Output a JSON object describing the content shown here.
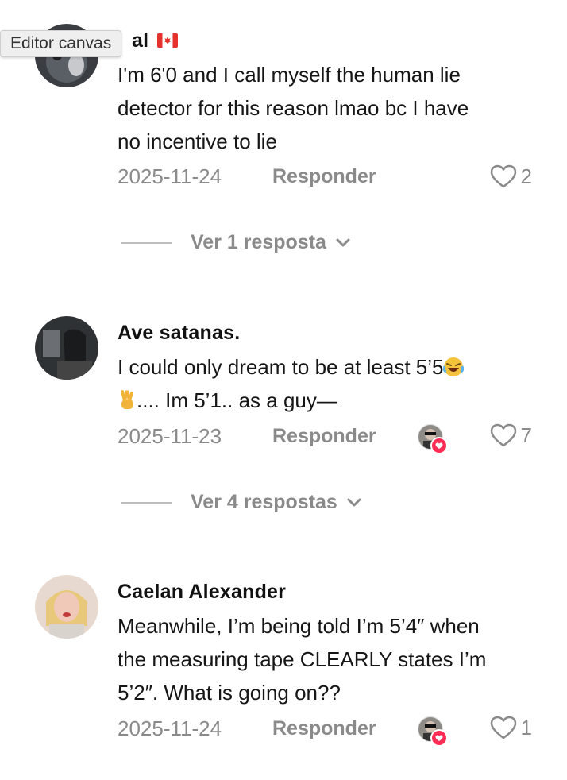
{
  "tooltip": "Editor canvas",
  "comments": [
    {
      "name_suffix": "al",
      "body": [
        "I'm 6'0 and I call myself the human lie",
        "detector for this reason lmao bc I have",
        "no incentive to lie"
      ],
      "date": "2025-11-24",
      "reply_label": "Responder",
      "likes": "2",
      "replies_label": "Ver 1 resposta"
    },
    {
      "name": "Ave satanas.",
      "body_line1": "I could only dream to be at least 5’5",
      "body_line2": ".... Im 5’1.. as a guy—",
      "date": "2025-11-23",
      "reply_label": "Responder",
      "likes": "7",
      "replies_label": "Ver 4 respostas"
    },
    {
      "name": "Caelan Alexander",
      "body": [
        "Meanwhile, I’m being told I’m 5’4″ when",
        "the measuring tape CLEARLY states I’m",
        "5’2″. What is going on??"
      ],
      "date": "2025-11-24",
      "reply_label": "Responder",
      "likes": "1"
    }
  ],
  "colors": {
    "secondary_text": "#8a8a8a",
    "like_badge": "#ff2c55"
  }
}
